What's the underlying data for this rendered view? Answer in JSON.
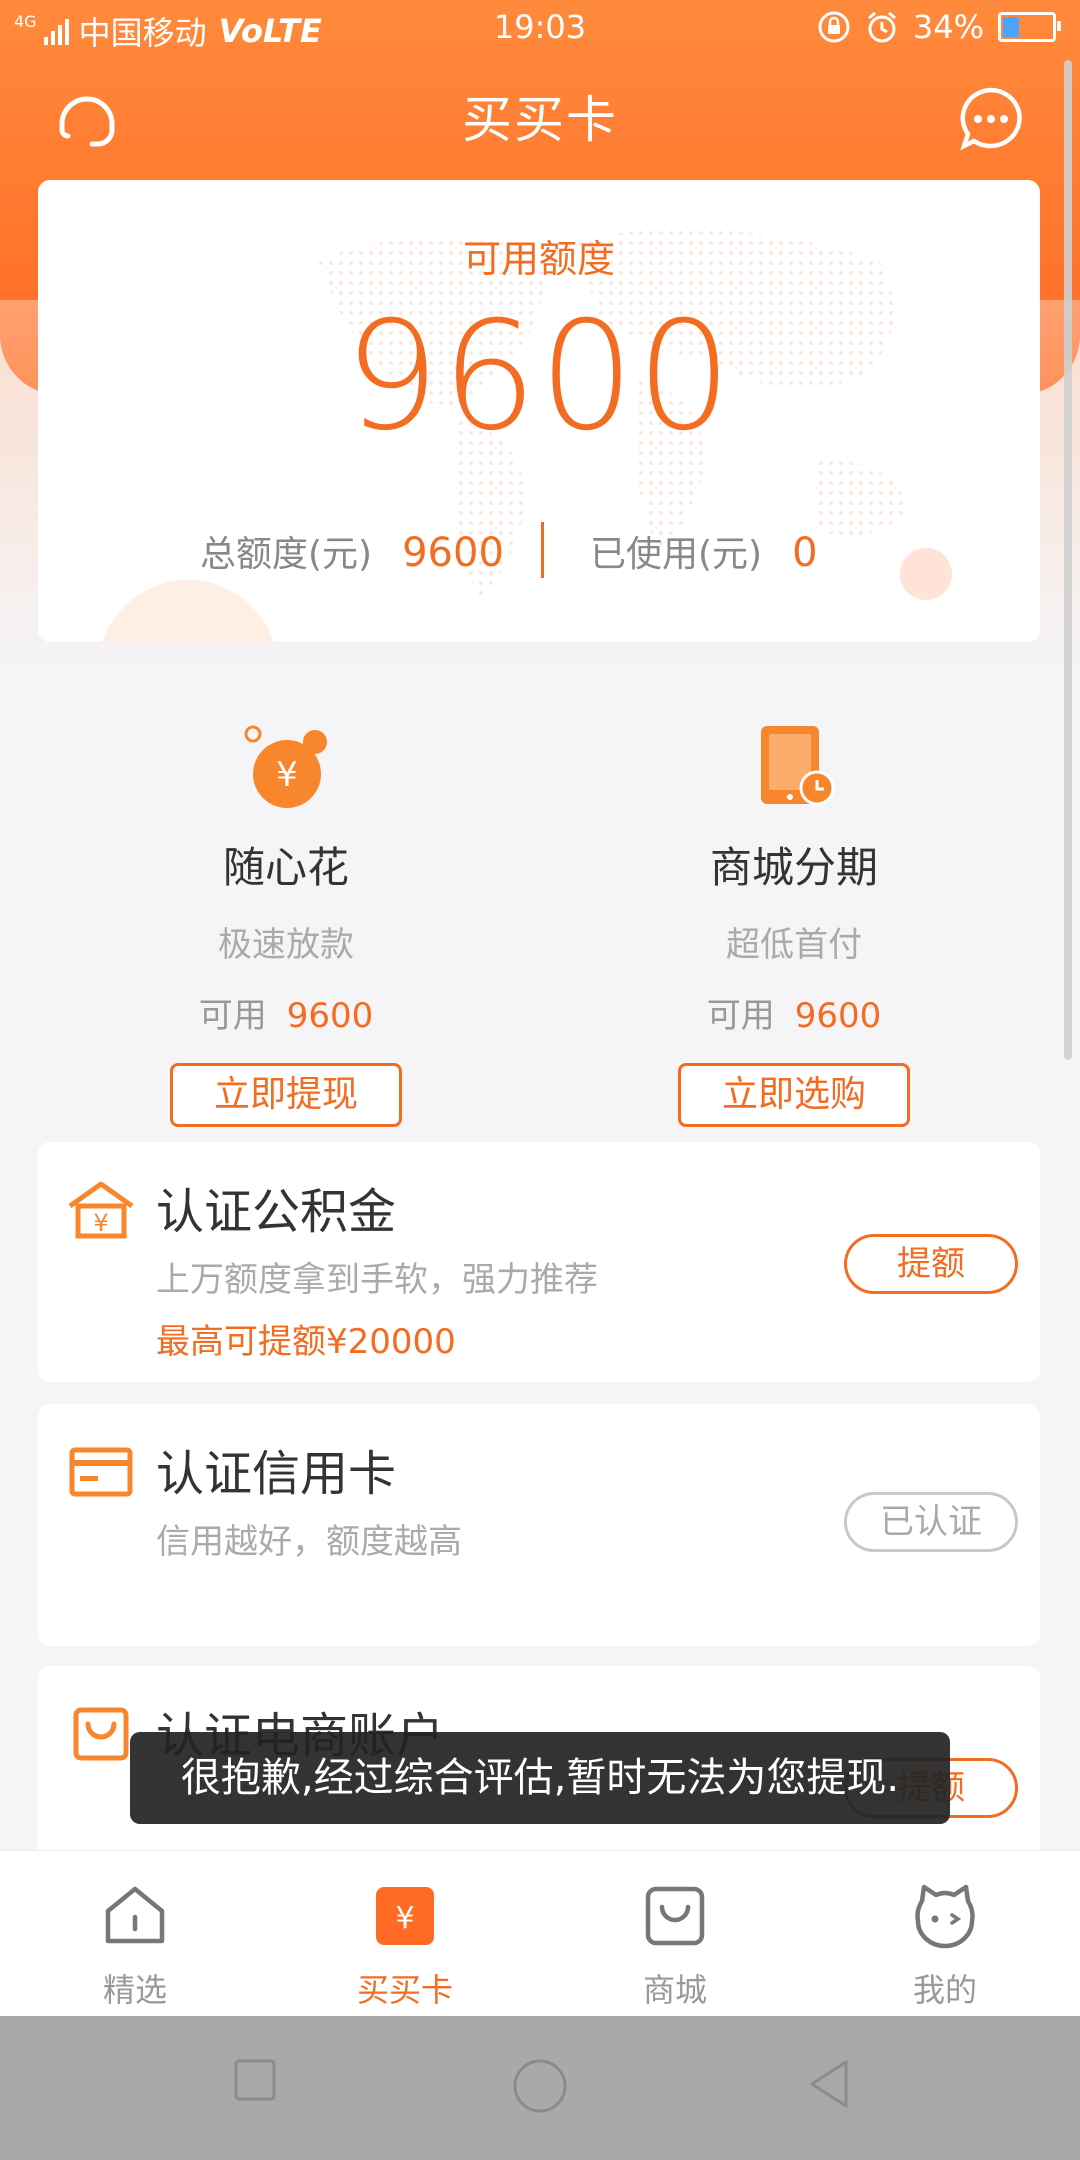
{
  "status_bar": {
    "network": "4G",
    "carrier": "中国移动",
    "volte": "VoLTE",
    "time": "19:03",
    "battery_percent": "34%",
    "battery_level": 0.34
  },
  "nav": {
    "title": "买买卡"
  },
  "credit": {
    "label": "可用额度",
    "amount": "9600",
    "total_label": "总额度(元)",
    "total_value": "9600",
    "used_label": "已使用(元)",
    "used_value": "0"
  },
  "products": [
    {
      "name": "随心花",
      "desc": "极速放款",
      "avail_label": "可用",
      "avail_value": "9600",
      "button": "立即提现"
    },
    {
      "name": "商城分期",
      "desc": "超低首付",
      "avail_label": "可用",
      "avail_value": "9600",
      "button": "立即选购"
    }
  ],
  "cards": [
    {
      "title": "认证公积金",
      "subtitle": "上万额度拿到手软，强力推荐",
      "highlight": "最高可提额¥20000",
      "action": "提额"
    },
    {
      "title": "认证信用卡",
      "subtitle": "信用越好，额度越高",
      "action": "已认证"
    },
    {
      "title": "认证电商账户",
      "action": "提额"
    }
  ],
  "toast": {
    "message": "很抱歉,经过综合评估,暂时无法为您提现."
  },
  "tabs": [
    {
      "label": "精选"
    },
    {
      "label": "买买卡"
    },
    {
      "label": "商城"
    },
    {
      "label": "我的"
    }
  ],
  "colors": {
    "accent": "#f36c21",
    "header": "#ff6a24"
  }
}
